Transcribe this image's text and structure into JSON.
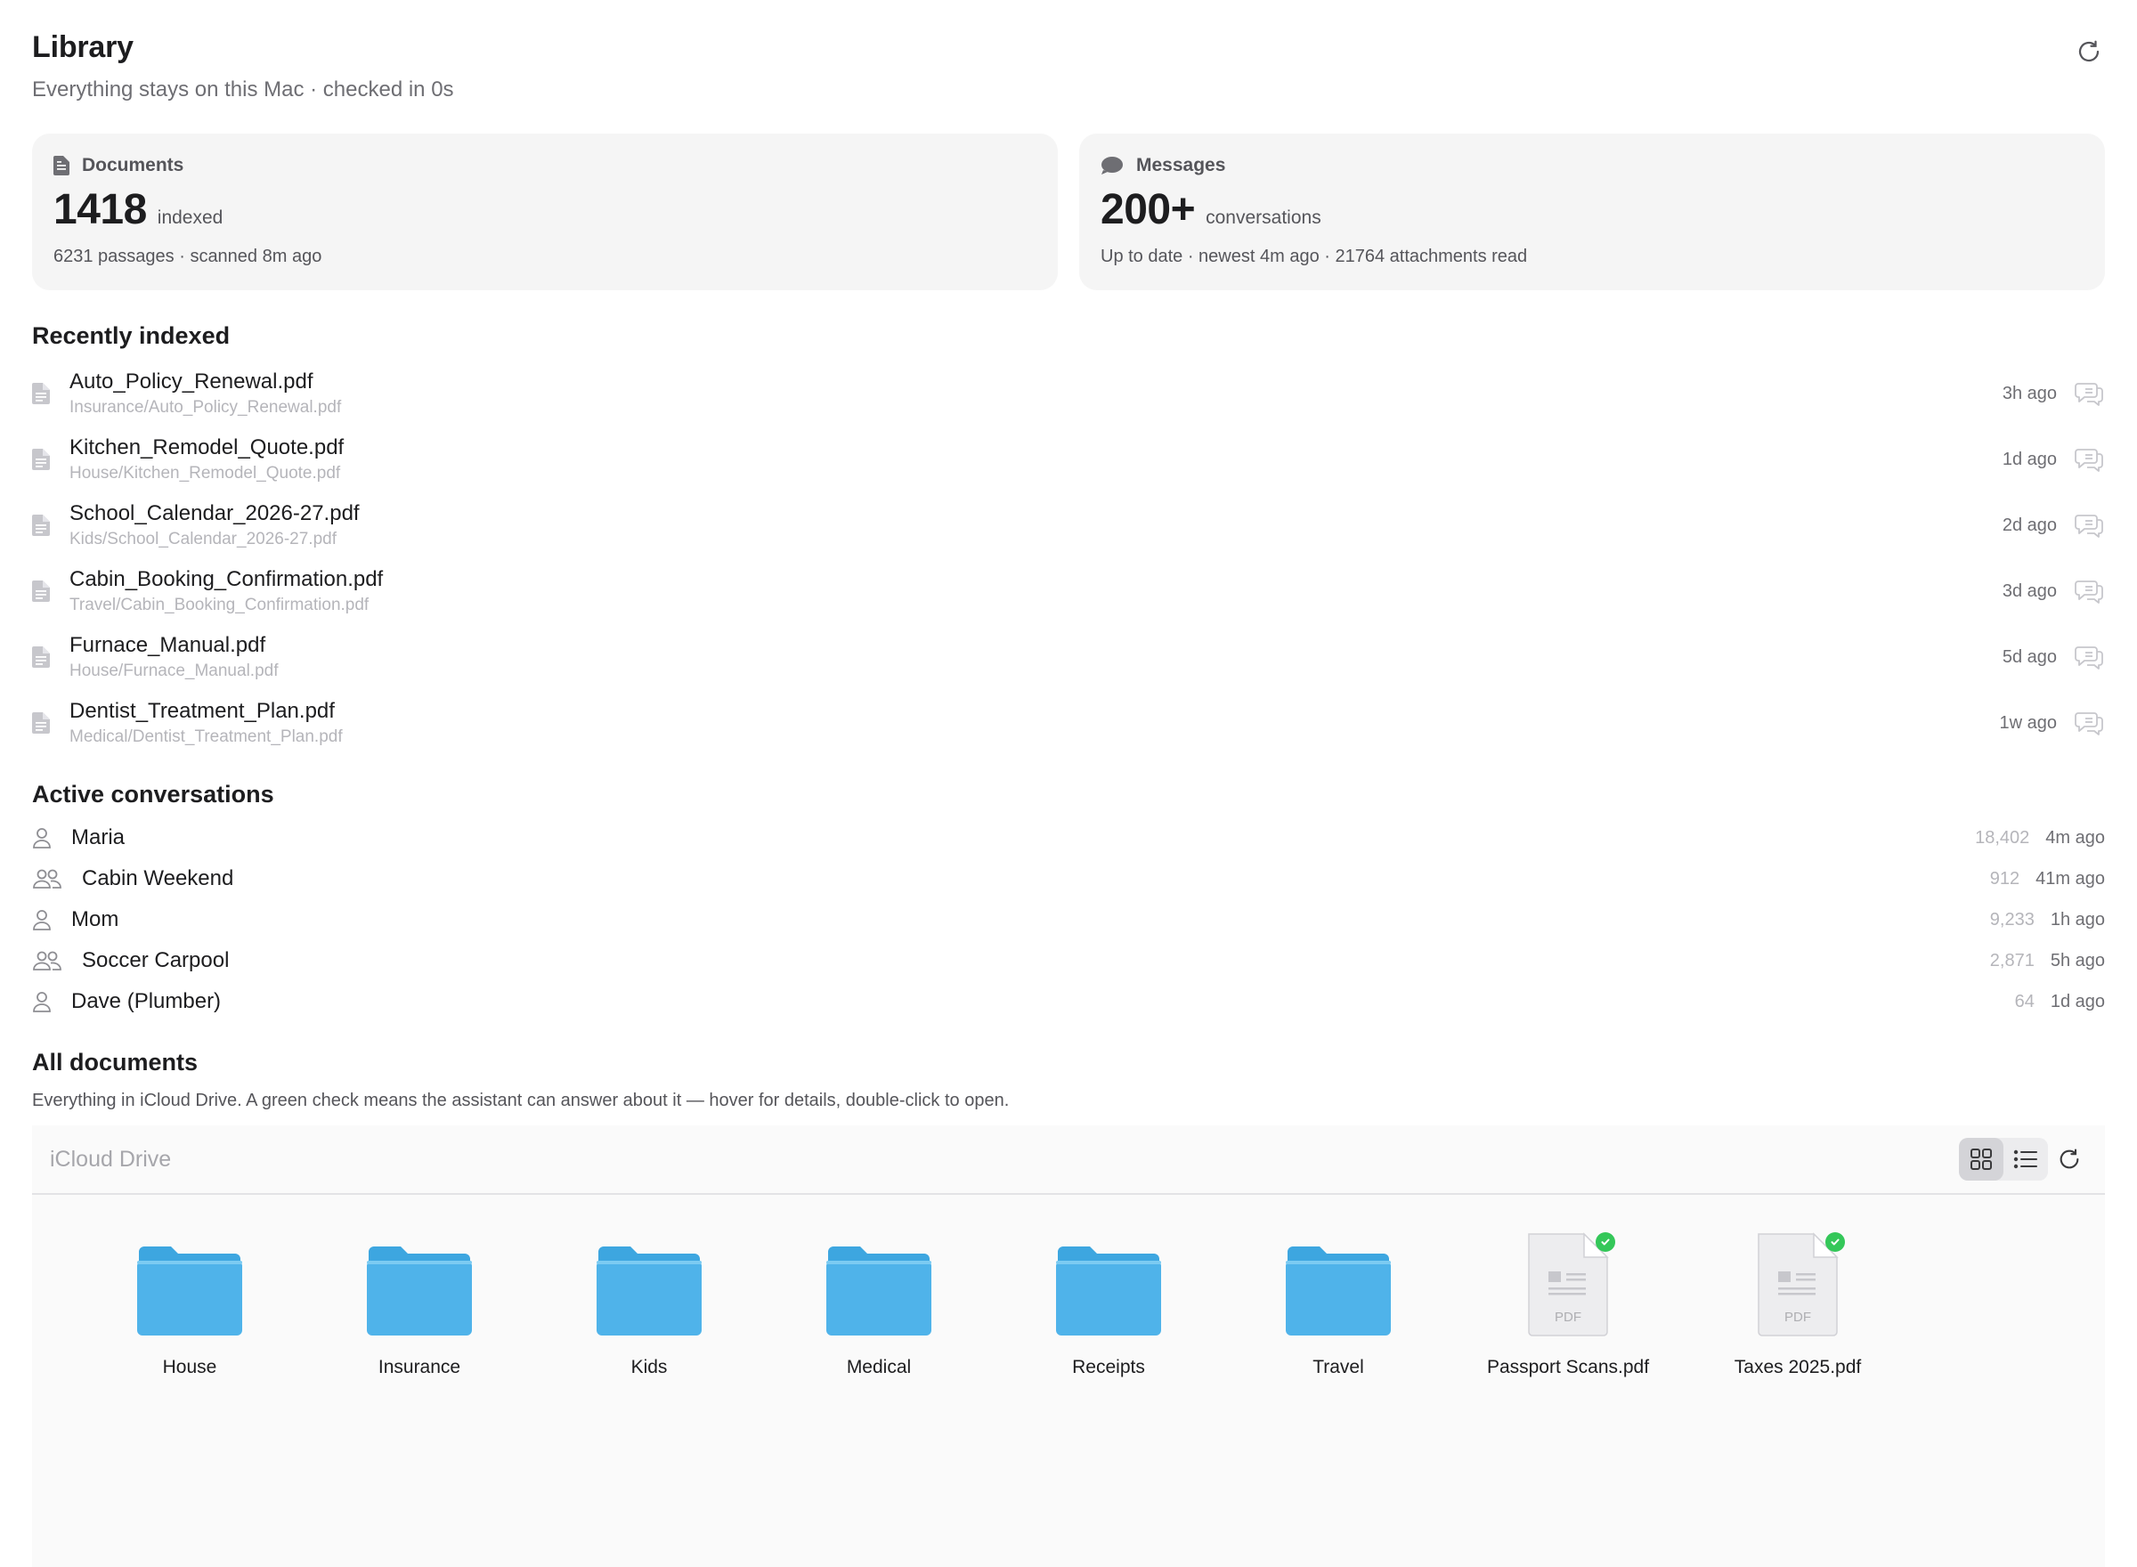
{
  "header": {
    "title": "Library",
    "subtitle": "Everything stays on this Mac · checked in 0s"
  },
  "stats": {
    "documents": {
      "label": "Documents",
      "count": "1418",
      "unit": "indexed",
      "detail": "6231 passages · scanned 8m ago"
    },
    "messages": {
      "label": "Messages",
      "count": "200+",
      "unit": "conversations",
      "detail": "Up to date · newest 4m ago · 21764 attachments read"
    }
  },
  "recent": {
    "title": "Recently indexed",
    "items": [
      {
        "name": "Auto_Policy_Renewal.pdf",
        "path": "Insurance/Auto_Policy_Renewal.pdf",
        "ago": "3h ago"
      },
      {
        "name": "Kitchen_Remodel_Quote.pdf",
        "path": "House/Kitchen_Remodel_Quote.pdf",
        "ago": "1d ago"
      },
      {
        "name": "School_Calendar_2026-27.pdf",
        "path": "Kids/School_Calendar_2026-27.pdf",
        "ago": "2d ago"
      },
      {
        "name": "Cabin_Booking_Confirmation.pdf",
        "path": "Travel/Cabin_Booking_Confirmation.pdf",
        "ago": "3d ago"
      },
      {
        "name": "Furnace_Manual.pdf",
        "path": "House/Furnace_Manual.pdf",
        "ago": "5d ago"
      },
      {
        "name": "Dentist_Treatment_Plan.pdf",
        "path": "Medical/Dentist_Treatment_Plan.pdf",
        "ago": "1w ago"
      }
    ]
  },
  "conversations": {
    "title": "Active conversations",
    "items": [
      {
        "name": "Maria",
        "type": "person-icon",
        "count": "18,402",
        "ago": "4m ago"
      },
      {
        "name": "Cabin Weekend",
        "type": "group-icon",
        "count": "912",
        "ago": "41m ago"
      },
      {
        "name": "Mom",
        "type": "person-icon",
        "count": "9,233",
        "ago": "1h ago"
      },
      {
        "name": "Soccer Carpool",
        "type": "group-icon",
        "count": "2,871",
        "ago": "5h ago"
      },
      {
        "name": "Dave (Plumber)",
        "type": "person-icon",
        "count": "64",
        "ago": "1d ago"
      }
    ]
  },
  "all_documents": {
    "title": "All documents",
    "description": "Everything in iCloud Drive. A green check means the assistant can answer about it — hover for details, double-click to open.",
    "browser_title": "iCloud Drive",
    "items": [
      {
        "label": "House",
        "kind": "folder"
      },
      {
        "label": "Insurance",
        "kind": "folder"
      },
      {
        "label": "Kids",
        "kind": "folder"
      },
      {
        "label": "Medical",
        "kind": "folder"
      },
      {
        "label": "Receipts",
        "kind": "folder"
      },
      {
        "label": "Travel",
        "kind": "folder"
      },
      {
        "label": "Passport Scans.pdf",
        "kind": "pdf",
        "indexed": true
      },
      {
        "label": "Taxes 2025.pdf",
        "kind": "pdf",
        "indexed": true
      }
    ],
    "pdf_badge": "PDF"
  },
  "colors": {
    "folder": "#4fb3ea",
    "check": "#34c759",
    "card": "#f5f5f5"
  }
}
